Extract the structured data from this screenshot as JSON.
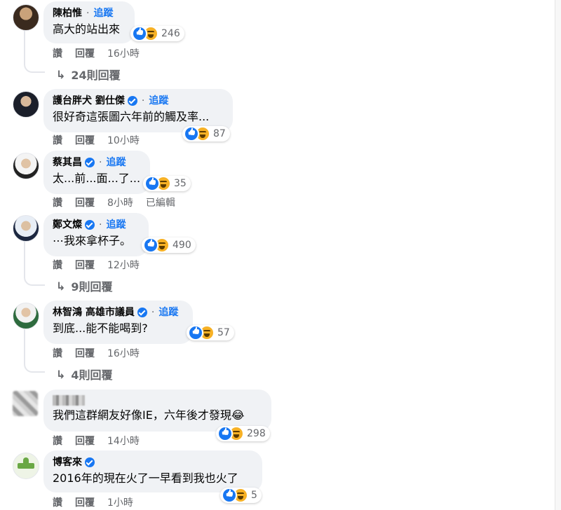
{
  "comments": [
    {
      "name": "陳柏惟",
      "verified": false,
      "follow": "追蹤",
      "text": "高大的站出來",
      "reactions": "246",
      "actions": {
        "like": "讚",
        "reply": "回覆",
        "time": "16小時"
      },
      "replies": "24則回覆"
    },
    {
      "name": "護台胖犬 劉仕傑",
      "verified": true,
      "follow": "追蹤",
      "text": "很好奇這張圖六年前的觸及率...",
      "reactions": "87",
      "actions": {
        "like": "讚",
        "reply": "回覆",
        "time": "10小時"
      }
    },
    {
      "name": "蔡其昌",
      "verified": true,
      "follow": "追蹤",
      "text": "太...前...面...了...",
      "reactions": "35",
      "actions": {
        "like": "讚",
        "reply": "回覆",
        "time": "8小時",
        "edited": "已編輯"
      }
    },
    {
      "name": "鄭文燦",
      "verified": true,
      "follow": "追蹤",
      "text": "⋯我來拿杯子。",
      "reactions": "490",
      "actions": {
        "like": "讚",
        "reply": "回覆",
        "time": "12小時"
      },
      "replies": "9則回覆"
    },
    {
      "name": "林智鴻 高雄市議員",
      "verified": true,
      "follow": "追蹤",
      "text": "到底...能不能喝到?",
      "reactions": "57",
      "actions": {
        "like": "讚",
        "reply": "回覆",
        "time": "16小時"
      },
      "replies": "4則回覆"
    },
    {
      "name": "",
      "verified": false,
      "follow": "",
      "text": "我們這群網友好像IE，六年後才發現😂",
      "reactions": "298",
      "actions": {
        "like": "讚",
        "reply": "回覆",
        "time": "14小時"
      }
    },
    {
      "name": "博客來",
      "verified": true,
      "follow": "",
      "text": "2016年的現在火了一早看到我也火了",
      "reactions": "5",
      "actions": {
        "like": "讚",
        "reply": "回覆",
        "time": "1小時"
      }
    }
  ],
  "colors": {
    "accent": "#1877f2",
    "bubble": "#f0f2f5",
    "meta": "#65676b"
  }
}
